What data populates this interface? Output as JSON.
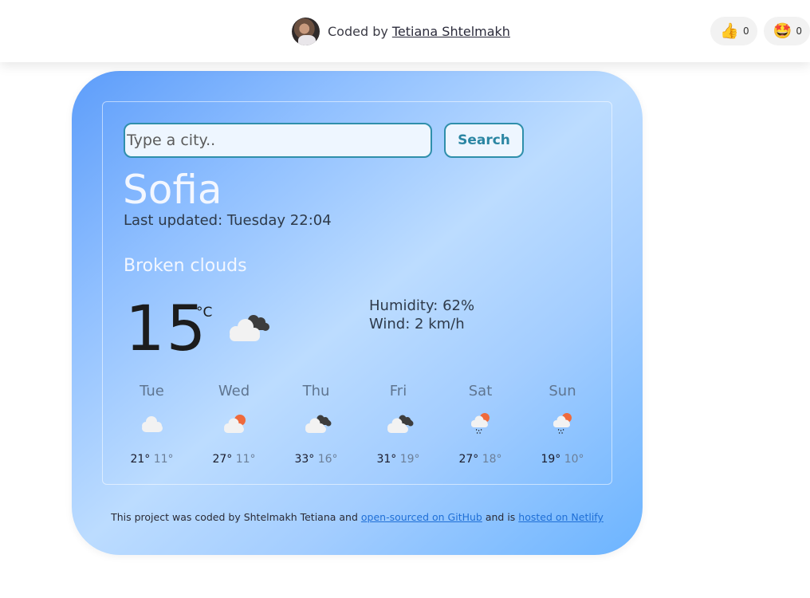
{
  "header": {
    "credit_prefix": "Coded by",
    "author_link": "Tetiana Shtelmakh",
    "reactions": [
      {
        "icon": "thumbs-up-icon",
        "glyph": "👍",
        "count": "0"
      },
      {
        "icon": "star-struck-icon",
        "glyph": "🤩",
        "count": "0"
      }
    ]
  },
  "search": {
    "placeholder": "Type a city..",
    "value": "",
    "button_label": "Search"
  },
  "current": {
    "city": "Sofia",
    "last_updated": "Last updated: Tuesday 22:04",
    "description": "Broken clouds",
    "temperature": "15",
    "unit": "°C",
    "icon": "broken-clouds-icon",
    "humidity": "Humidity: 62%",
    "wind": "Wind: 2 km/h"
  },
  "forecast": [
    {
      "day": "Tue",
      "icon": "cloud-icon",
      "max": "21°",
      "min": "11°"
    },
    {
      "day": "Wed",
      "icon": "partly-cloudy-icon",
      "max": "27°",
      "min": "11°"
    },
    {
      "day": "Thu",
      "icon": "broken-clouds-icon",
      "max": "33°",
      "min": "16°"
    },
    {
      "day": "Fri",
      "icon": "broken-clouds-icon",
      "max": "31°",
      "min": "19°"
    },
    {
      "day": "Sat",
      "icon": "rain-sun-icon",
      "max": "27°",
      "min": "18°"
    },
    {
      "day": "Sun",
      "icon": "rain-sun-icon",
      "max": "19°",
      "min": "10°"
    }
  ],
  "footer": {
    "text_1": "This project was coded by Shtelmakh Tetiana and ",
    "link_github": "open-sourced on GitHub",
    "text_2": " and is ",
    "link_netlify": "hosted on Netlify"
  },
  "colors": {
    "accent": "#2f8fab",
    "link": "#1f6fd6",
    "sun": "#ef6a3c",
    "dark_cloud": "#3d3d3d"
  }
}
